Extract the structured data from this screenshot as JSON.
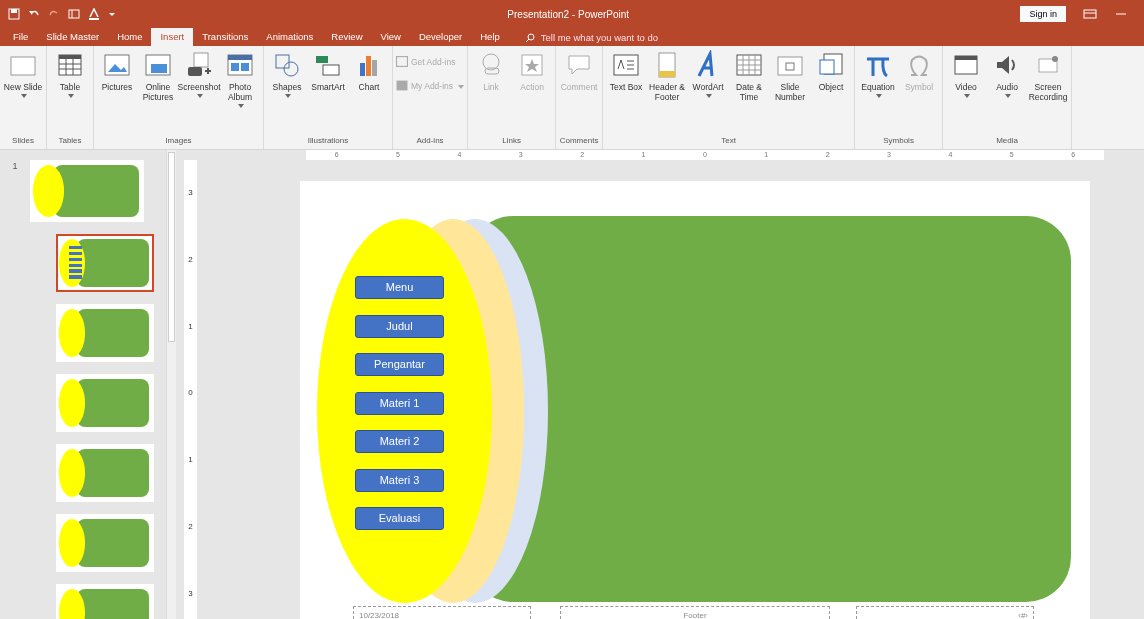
{
  "window": {
    "title": "Presentation2 - PowerPoint",
    "sign_in": "Sign in"
  },
  "tabs": [
    {
      "label": "File",
      "selected": false
    },
    {
      "label": "Slide Master",
      "selected": false
    },
    {
      "label": "Home",
      "selected": false
    },
    {
      "label": "Insert",
      "selected": true
    },
    {
      "label": "Transitions",
      "selected": false
    },
    {
      "label": "Animations",
      "selected": false
    },
    {
      "label": "Review",
      "selected": false
    },
    {
      "label": "View",
      "selected": false
    },
    {
      "label": "Developer",
      "selected": false
    },
    {
      "label": "Help",
      "selected": false
    }
  ],
  "tell_me": {
    "placeholder": "Tell me what you want to do"
  },
  "ribbon": [
    {
      "group": "Slides",
      "items": [
        {
          "label": "New Slide",
          "dropdown": true,
          "disabled": false,
          "kind": "large"
        }
      ]
    },
    {
      "group": "Tables",
      "items": [
        {
          "label": "Table",
          "dropdown": true,
          "disabled": false,
          "kind": "large"
        }
      ]
    },
    {
      "group": "Images",
      "items": [
        {
          "label": "Pictures",
          "dropdown": false,
          "disabled": false,
          "kind": "large"
        },
        {
          "label": "Online Pictures",
          "dropdown": false,
          "disabled": false,
          "kind": "large"
        },
        {
          "label": "Screenshot",
          "dropdown": true,
          "disabled": false,
          "kind": "large"
        },
        {
          "label": "Photo Album",
          "dropdown": true,
          "disabled": false,
          "kind": "large"
        }
      ]
    },
    {
      "group": "Illustrations",
      "items": [
        {
          "label": "Shapes",
          "dropdown": true,
          "disabled": false,
          "kind": "large"
        },
        {
          "label": "SmartArt",
          "dropdown": false,
          "disabled": false,
          "kind": "large"
        },
        {
          "label": "Chart",
          "dropdown": false,
          "disabled": false,
          "kind": "large"
        }
      ]
    },
    {
      "group": "Add-ins",
      "items": [
        {
          "label": "Get Add-ins",
          "dropdown": false,
          "disabled": true,
          "kind": "small"
        },
        {
          "label": "My Add-ins",
          "dropdown": true,
          "disabled": true,
          "kind": "small"
        }
      ]
    },
    {
      "group": "Links",
      "items": [
        {
          "label": "Link",
          "dropdown": false,
          "disabled": true,
          "kind": "large"
        },
        {
          "label": "Action",
          "dropdown": false,
          "disabled": true,
          "kind": "large"
        }
      ]
    },
    {
      "group": "Comments",
      "items": [
        {
          "label": "Comment",
          "dropdown": false,
          "disabled": true,
          "kind": "large"
        }
      ]
    },
    {
      "group": "Text",
      "items": [
        {
          "label": "Text Box",
          "dropdown": false,
          "disabled": false,
          "kind": "large"
        },
        {
          "label": "Header & Footer",
          "dropdown": false,
          "disabled": false,
          "kind": "large"
        },
        {
          "label": "WordArt",
          "dropdown": true,
          "disabled": false,
          "kind": "large"
        },
        {
          "label": "Date & Time",
          "dropdown": false,
          "disabled": false,
          "kind": "large"
        },
        {
          "label": "Slide Number",
          "dropdown": false,
          "disabled": false,
          "kind": "large"
        },
        {
          "label": "Object",
          "dropdown": false,
          "disabled": false,
          "kind": "large"
        }
      ]
    },
    {
      "group": "Symbols",
      "items": [
        {
          "label": "Equation",
          "dropdown": true,
          "disabled": false,
          "kind": "large"
        },
        {
          "label": "Symbol",
          "dropdown": false,
          "disabled": true,
          "kind": "large"
        }
      ]
    },
    {
      "group": "Media",
      "items": [
        {
          "label": "Video",
          "dropdown": true,
          "disabled": false,
          "kind": "large"
        },
        {
          "label": "Audio",
          "dropdown": true,
          "disabled": false,
          "kind": "large"
        },
        {
          "label": "Screen Recording",
          "dropdown": false,
          "disabled": false,
          "kind": "large"
        }
      ]
    }
  ],
  "ruler": {
    "horizontal": [
      "6",
      "5",
      "4",
      "3",
      "2",
      "1",
      "0",
      "1",
      "2",
      "3",
      "4",
      "5",
      "6"
    ],
    "vertical": [
      "3",
      "2",
      "1",
      "0",
      "1",
      "2",
      "3"
    ]
  },
  "thumbnails": [
    {
      "number": "1",
      "selected": false,
      "buttons": false
    },
    {
      "selected": true,
      "buttons": true
    },
    {
      "selected": false,
      "buttons": false
    },
    {
      "selected": false,
      "buttons": false
    },
    {
      "selected": false,
      "buttons": false
    },
    {
      "selected": false,
      "buttons": false
    },
    {
      "selected": false,
      "buttons": false
    }
  ],
  "slide": {
    "menu_buttons": [
      "Menu",
      "Judul",
      "Pengantar",
      "Materi 1",
      "Materi 2",
      "Materi 3",
      "Evaluasi"
    ],
    "footer": {
      "date": "10/23/2018",
      "text": "Footer",
      "number": "‹#›"
    }
  }
}
